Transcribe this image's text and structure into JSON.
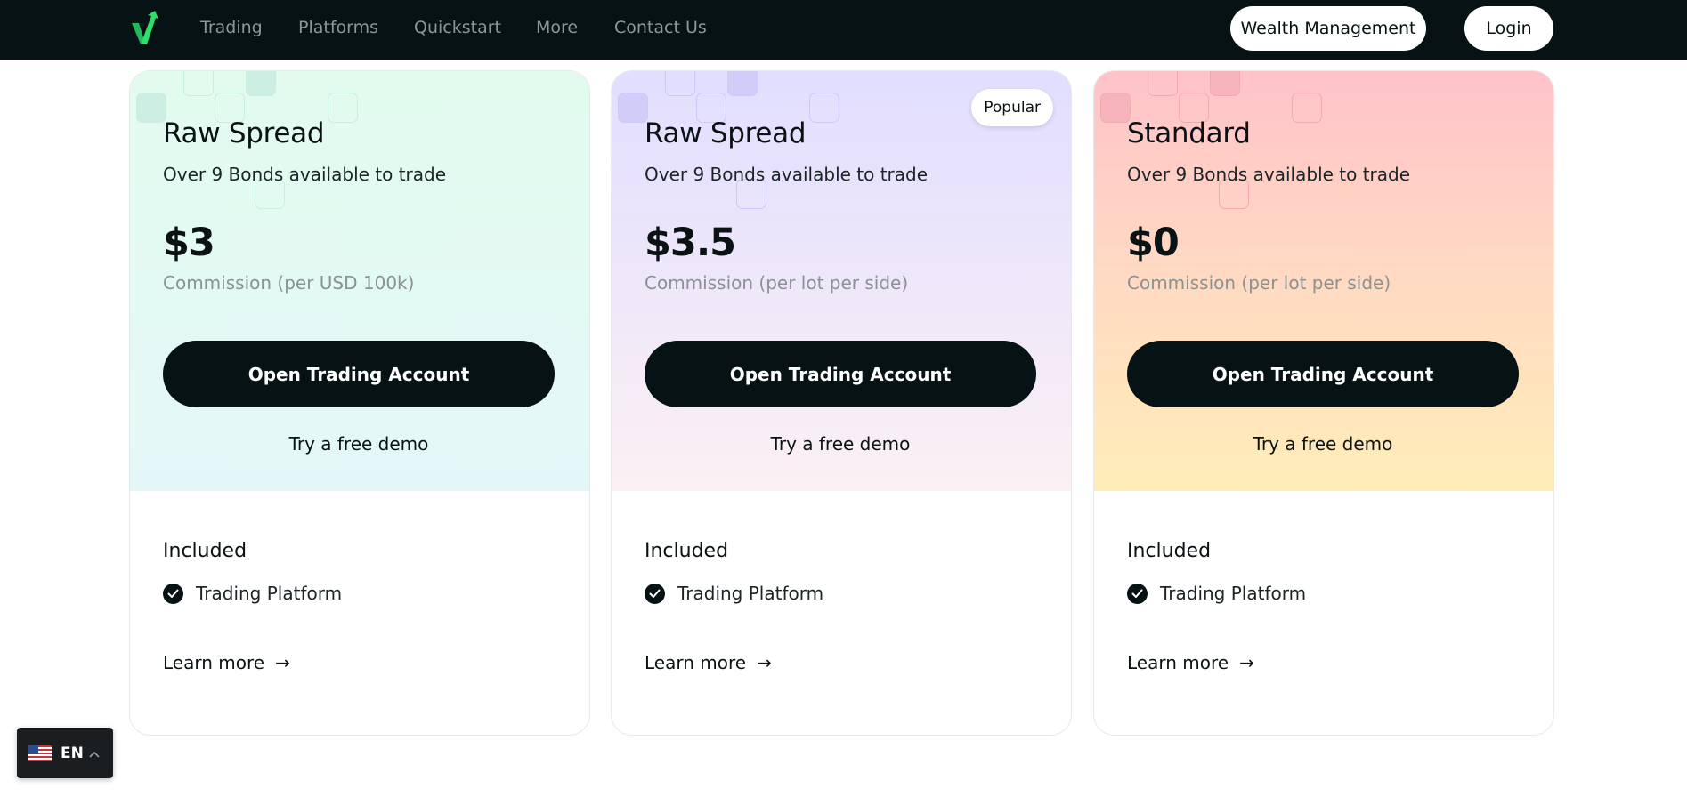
{
  "nav": {
    "links": [
      "Trading",
      "Platforms",
      "Quickstart",
      "More",
      "Contact Us"
    ],
    "wealth_label": "Wealth Management",
    "login_label": "Login"
  },
  "cards": [
    {
      "name": "Raw Spread",
      "subtitle": "Over 9 Bonds available to trade",
      "price": "$3",
      "price_note": "Commission (per USD 100k)",
      "cta": "Open Trading Account",
      "demo": "Try a free demo",
      "included_title": "Included",
      "feature": "Trading Platform",
      "learn_more": "Learn more"
    },
    {
      "name": "Raw Spread",
      "badge": "Popular",
      "subtitle": "Over 9 Bonds available to trade",
      "price": "$3.5",
      "price_note": "Commission (per lot per side)",
      "cta": "Open Trading Account",
      "demo": "Try a free demo",
      "included_title": "Included",
      "feature": "Trading Platform",
      "learn_more": "Learn more"
    },
    {
      "name": "Standard",
      "subtitle": "Over 9 Bonds available to trade",
      "price": "$0",
      "price_note": "Commission (per lot per side)",
      "cta": "Open Trading Account",
      "demo": "Try a free demo",
      "included_title": "Included",
      "feature": "Trading Platform",
      "learn_more": "Learn more"
    }
  ],
  "language": {
    "code": "EN"
  },
  "colors": {
    "nav_bg": "#061214",
    "logo_green": "#2ee06b",
    "card1_top": "#e2fbee",
    "card2_top": "#e1deff",
    "card3_top": "#ffc2c9",
    "button_dark": "#061214"
  },
  "icons": [
    "brand-logo-icon",
    "check-circle-icon",
    "arrow-right-icon",
    "us-flag-icon",
    "chevron-up-icon"
  ]
}
